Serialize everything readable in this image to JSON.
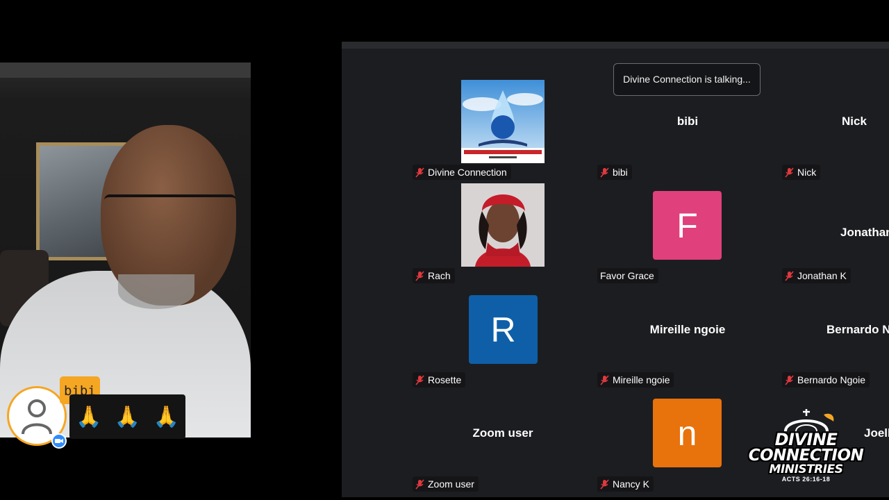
{
  "meeting": {
    "talking_indicator": "Divine Connection is talking..."
  },
  "reaction": {
    "user_name": "bibi",
    "emojis": [
      "🙏",
      "🙏",
      "🙏"
    ]
  },
  "tiles": [
    {
      "tile_name": "",
      "label": "Divine Connection",
      "kind": "image"
    },
    {
      "tile_name": "bibi",
      "label": "bibi",
      "kind": "name"
    },
    {
      "tile_name": "Nick",
      "label": "Nick",
      "kind": "name"
    },
    {
      "tile_name": "",
      "label": "Rach",
      "kind": "photo"
    },
    {
      "tile_name": "",
      "initial": "F",
      "label": "Favor Grace",
      "kind": "initial",
      "color": "#e0407c"
    },
    {
      "tile_name": "Jonathan",
      "label": "Jonathan K",
      "kind": "name"
    },
    {
      "tile_name": "",
      "initial": "R",
      "label": "Rosette",
      "kind": "initial",
      "color": "#0e5fa8"
    },
    {
      "tile_name": "Mireille ngoie",
      "label": "Mireille ngoie",
      "kind": "name"
    },
    {
      "tile_name": "Bernardo N",
      "label": "Bernardo Ngoie",
      "kind": "name"
    },
    {
      "tile_name": "Zoom user",
      "label": "Zoom user",
      "kind": "name"
    },
    {
      "tile_name": "",
      "initial": "n",
      "label": "Nancy K",
      "kind": "initial",
      "color": "#e8720c"
    },
    {
      "tile_name": "Joelle I",
      "label": "",
      "kind": "name"
    }
  ],
  "logo": {
    "line1": "DIVINE",
    "line2": "CONNECTION",
    "line3": "MINISTRIES",
    "verse": "ACTS 26:16-18"
  },
  "colors": {
    "gallery_bg": "#1c1d21",
    "mic_off": "#e0393e",
    "accent": "#f5a623",
    "zoom_blue": "#2d8cff"
  }
}
